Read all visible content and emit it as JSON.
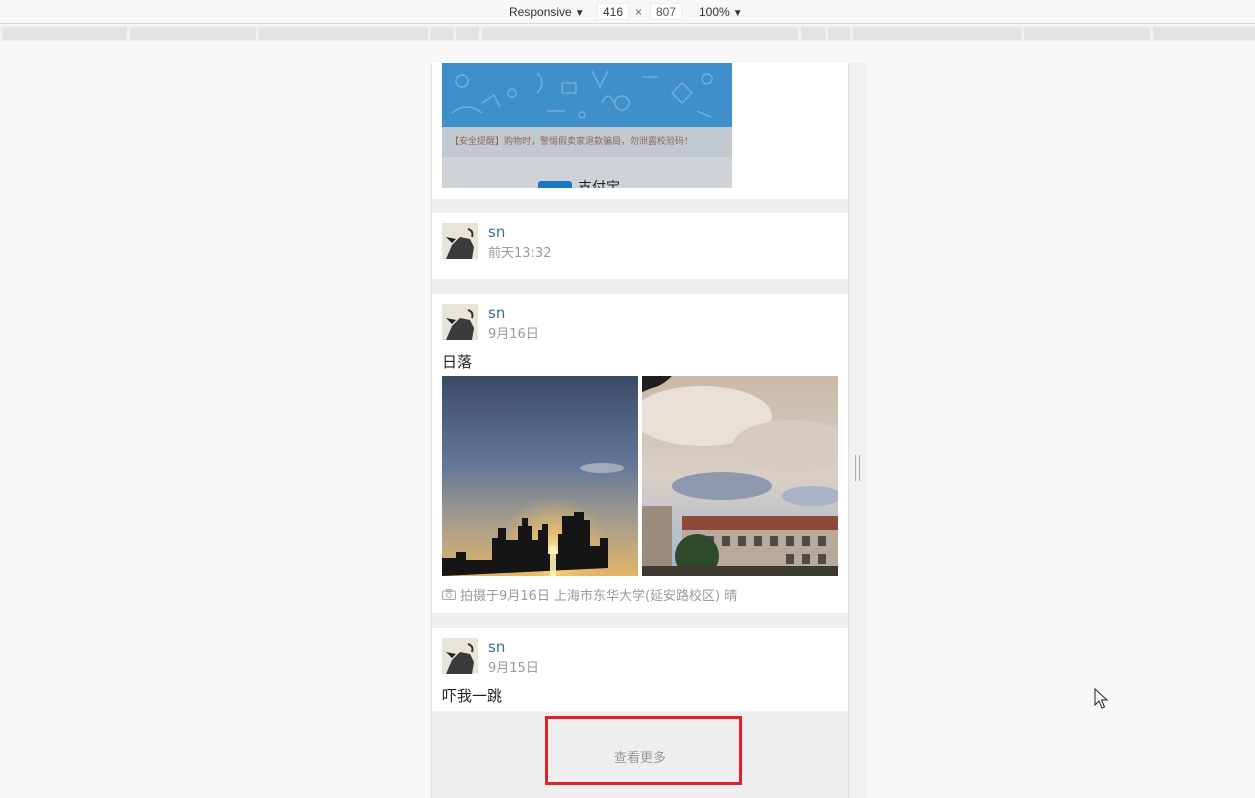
{
  "devtools": {
    "device_preset": "Responsive",
    "width": "416",
    "times": "×",
    "height": "807",
    "zoom": "100%"
  },
  "feed": {
    "banner": {
      "notice": "【安全提醒】购物时，警惕假卖家退款骗局，勿泄露校验码！",
      "logo_text": "支付宝"
    },
    "posts": [
      {
        "username": "sn",
        "time": "前天13:32"
      },
      {
        "username": "sn",
        "time": "9月16日",
        "text": "日落",
        "meta": "拍摄于9月16日 上海市东华大学(延安路校区) 晴"
      },
      {
        "username": "sn",
        "time": "9月15日",
        "text": "吓我一跳"
      }
    ],
    "load_more": "查看更多"
  },
  "icons": {
    "camera": "camera-icon",
    "caret": "caret-down-icon",
    "cursor": "mouse-pointer-icon"
  }
}
